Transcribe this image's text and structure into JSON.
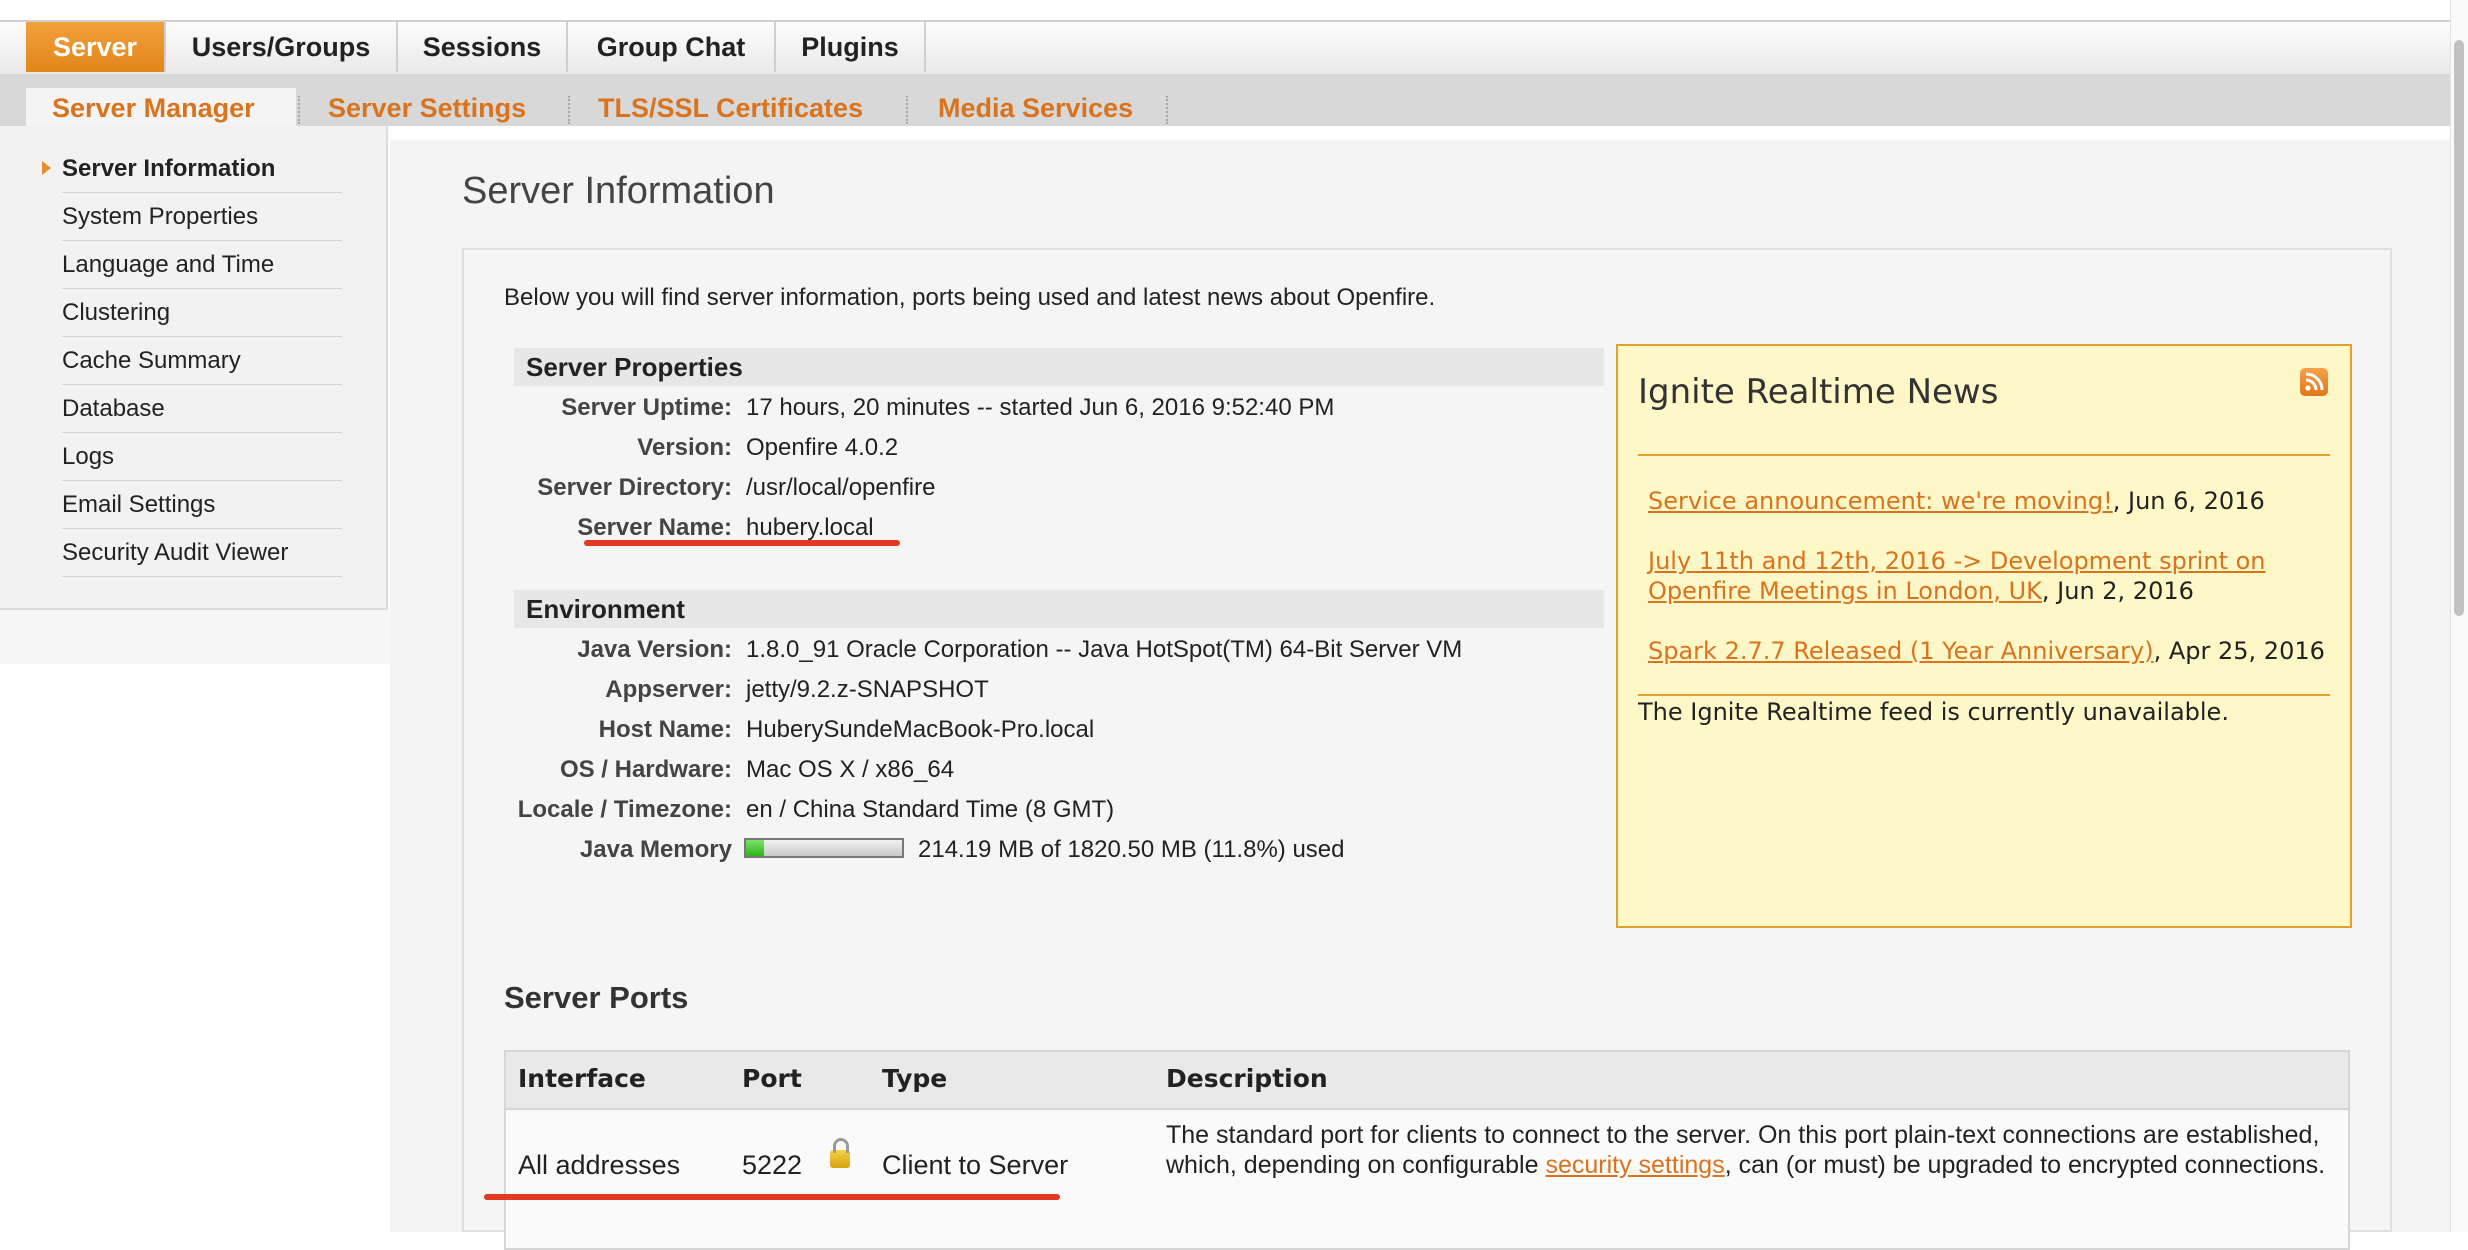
{
  "top_nav": {
    "tabs": [
      {
        "label": "Server",
        "active": true
      },
      {
        "label": "Users/Groups",
        "active": false
      },
      {
        "label": "Sessions",
        "active": false
      },
      {
        "label": "Group Chat",
        "active": false
      },
      {
        "label": "Plugins",
        "active": false
      }
    ]
  },
  "sub_nav": {
    "tabs": [
      {
        "label": "Server Manager",
        "active": true
      },
      {
        "label": "Server Settings",
        "active": false
      },
      {
        "label": "TLS/SSL Certificates",
        "active": false
      },
      {
        "label": "Media Services",
        "active": false
      }
    ]
  },
  "sidebar": {
    "items": [
      {
        "label": "Server Information",
        "active": true
      },
      {
        "label": "System Properties"
      },
      {
        "label": "Language and Time"
      },
      {
        "label": "Clustering"
      },
      {
        "label": "Cache Summary"
      },
      {
        "label": "Database"
      },
      {
        "label": "Logs"
      },
      {
        "label": "Email Settings"
      },
      {
        "label": "Security Audit Viewer"
      }
    ]
  },
  "main": {
    "title": "Server Information",
    "intro": "Below you will find server information, ports being used and latest news about Openfire.",
    "server_properties": {
      "heading": "Server Properties",
      "rows": [
        {
          "label": "Server Uptime:",
          "value": "17 hours, 20 minutes -- started Jun 6, 2016 9:52:40 PM"
        },
        {
          "label": "Version:",
          "value": "Openfire 4.0.2"
        },
        {
          "label": "Server Directory:",
          "value": "/usr/local/openfire"
        },
        {
          "label": "Server Name:",
          "value": "hubery.local"
        }
      ]
    },
    "environment": {
      "heading": "Environment",
      "rows": [
        {
          "label": "Java Version:",
          "value": "1.8.0_91 Oracle Corporation -- Java HotSpot(TM) 64-Bit Server VM"
        },
        {
          "label": "Appserver:",
          "value": "jetty/9.2.z-SNAPSHOT"
        },
        {
          "label": "Host Name:",
          "value": "HuberySundeMacBook-Pro.local"
        },
        {
          "label": "OS / Hardware:",
          "value": "Mac OS X / x86_64"
        },
        {
          "label": "Locale / Timezone:",
          "value": "en / China Standard Time (8 GMT)"
        }
      ],
      "memory": {
        "label": "Java Memory",
        "text": "214.19 MB of 1820.50 MB (11.8%) used",
        "used_fraction": 0.118
      }
    },
    "news": {
      "title": "Ignite Realtime News",
      "icon": "rss-icon",
      "items": [
        {
          "link": "Service announcement: we're moving!",
          "date": ", Jun 6, 2016"
        },
        {
          "link": "July 11th and 12th, 2016 -> Development sprint on Openfire Meetings in London, UK",
          "date": ", Jun 2, 2016"
        },
        {
          "link": "Spark 2.7.7 Released (1 Year Anniversary)",
          "date": ", Apr 25, 2016"
        }
      ],
      "status": "The Ignite Realtime feed is currently unavailable."
    },
    "ports": {
      "title": "Server Ports",
      "headers": [
        "Interface",
        "Port",
        "Type",
        "Description"
      ],
      "rows": [
        {
          "interface": "All addresses",
          "port": "5222",
          "icon": "lock-icon",
          "type": "Client to Server",
          "description_before": "The standard port for clients to connect to the server. On this port plain-text connections are established, which, depending on configurable ",
          "description_link": "security settings",
          "description_after": ", can (or must) be upgraded to encrypted connections."
        }
      ]
    }
  },
  "colors": {
    "accent": "#e2861a",
    "link": "#d9731e",
    "annotation_red": "#e23a22",
    "news_bg": "#fef7c8"
  }
}
